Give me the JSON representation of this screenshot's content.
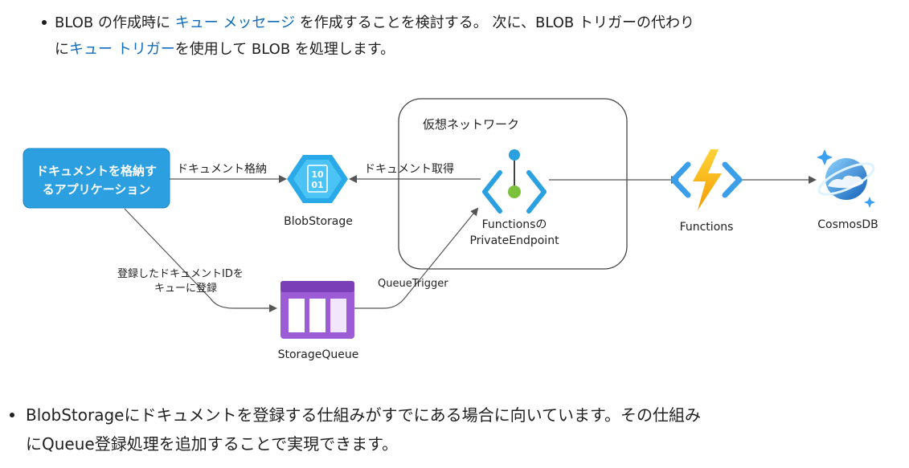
{
  "top_bullet": {
    "seg1": "BLOB の作成時に ",
    "link1": "キュー メッセージ",
    "seg2": " を作成することを検討する。 次に、BLOB トリガーの代わり",
    "seg3": "に",
    "link2": "キュー トリガー",
    "seg4": "を使用して BLOB を処理します。"
  },
  "diagram": {
    "vnet_label": "仮想ネットワーク",
    "app_line1": "ドキュメントを格納す",
    "app_line2": "るアプリケーション",
    "edge_store": "ドキュメント格納",
    "edge_fetch": "ドキュメント取得",
    "edge_register_line1": "登録したドキュメントIDを",
    "edge_register_line2": "キューに登録",
    "edge_queue_trigger": "QueueTrigger",
    "blob_label": "BlobStorage",
    "blob_icon_text_1": "10",
    "blob_icon_text_2": "01",
    "endpoint_line1": "Functionsの",
    "endpoint_line2": "PrivateEndpoint",
    "functions_label": "Functions",
    "cosmos_label": "CosmosDB",
    "queue_label": "StorageQueue",
    "colors": {
      "app_box": "#2b9fe0",
      "queue": "#9b5cd6",
      "blob": "#2aa9e8",
      "functions_bolt": "#f5b700",
      "arrow": "#555555"
    }
  },
  "bottom_bullet": {
    "line1": "BlobStorageにドキュメントを登録する仕組みがすでにある場合に向いています。その仕組み",
    "line2": "にQueue登録処理を追加することで実現できます。"
  }
}
